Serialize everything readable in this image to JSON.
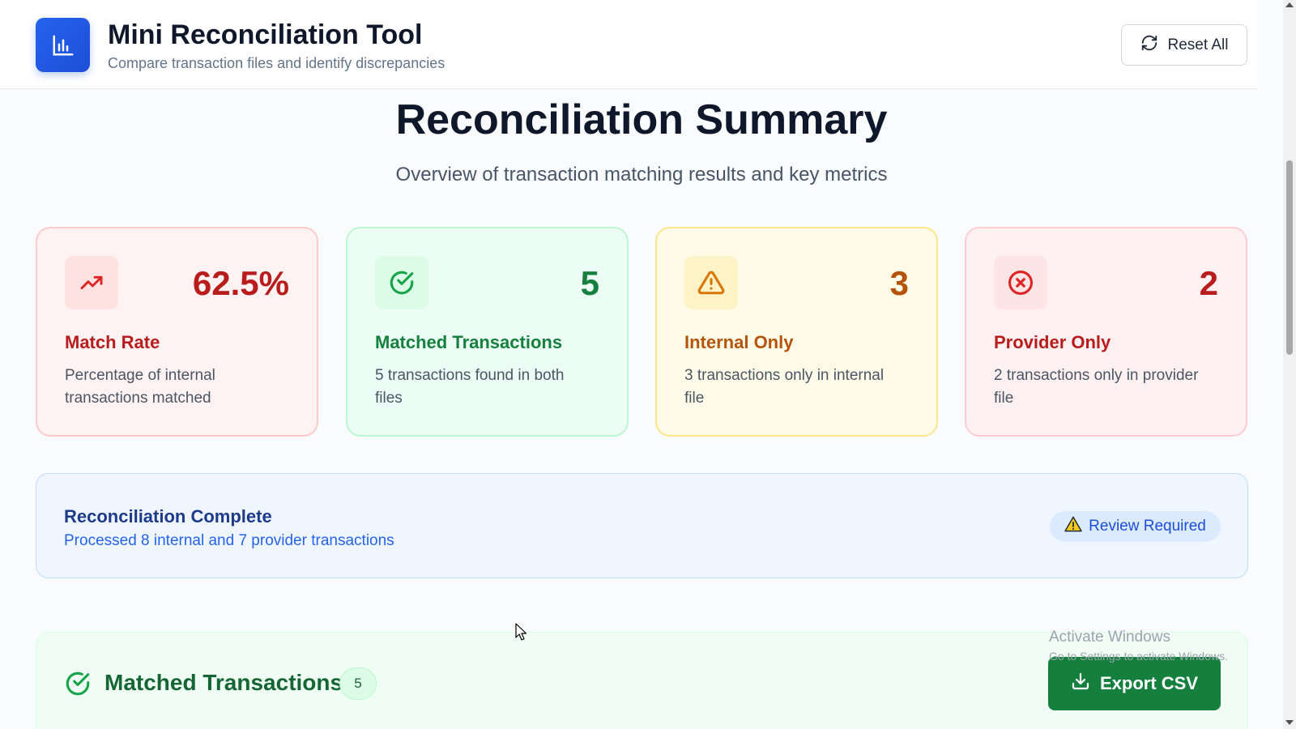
{
  "header": {
    "title": "Mini Reconciliation Tool",
    "subtitle": "Compare transaction files and identify discrepancies",
    "logo_icon": "bar-chart-icon",
    "reset_label": "Reset All",
    "reset_icon": "refresh-icon"
  },
  "summary": {
    "title": "Reconciliation Summary",
    "subtitle": "Overview of transaction matching results and key metrics"
  },
  "cards": [
    {
      "icon": "trending-up-icon",
      "value": "62.5%",
      "label": "Match Rate",
      "description": "Percentage of internal transactions matched",
      "color": "#b91c1c"
    },
    {
      "icon": "check-circle-icon",
      "value": "5",
      "label": "Matched Transactions",
      "description": "5 transactions found in both files",
      "color": "#15803d"
    },
    {
      "icon": "warning-triangle-icon",
      "value": "3",
      "label": "Internal Only",
      "description": "3 transactions only in internal file",
      "color": "#b45309"
    },
    {
      "icon": "x-circle-icon",
      "value": "2",
      "label": "Provider Only",
      "description": "2 transactions only in provider file",
      "color": "#b91c1c"
    }
  ],
  "status": {
    "title": "Reconciliation Complete",
    "text": "Processed 8 internal and 7 provider transactions",
    "badge_label": "Review Required",
    "badge_icon": "warning-icon"
  },
  "matched_section": {
    "title": "Matched Transactions",
    "count": "5",
    "icon": "check-circle-icon",
    "export_label": "Export CSV",
    "export_icon": "download-icon"
  },
  "watermark": {
    "title": "Activate Windows",
    "subtitle": "Go to Settings to activate Windows."
  }
}
